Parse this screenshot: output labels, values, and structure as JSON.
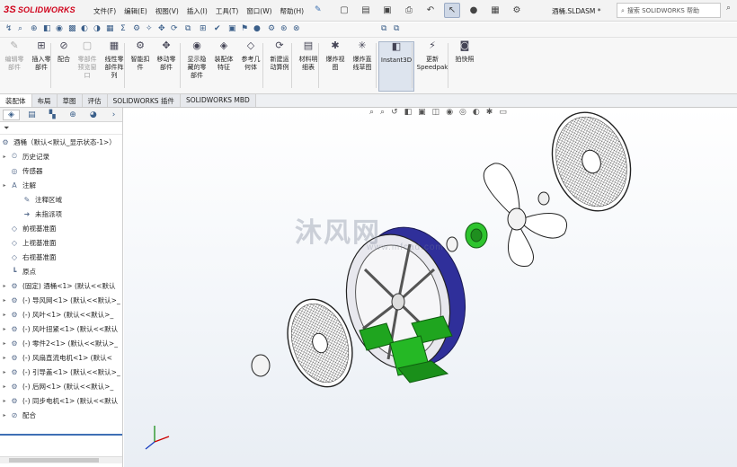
{
  "app": {
    "logo": "SOLIDWORKS",
    "logo_mark": "3S"
  },
  "menu": [
    "文件(F)",
    "编辑(E)",
    "视图(V)",
    "插入(I)",
    "工具(T)",
    "窗口(W)",
    "帮助(H)"
  ],
  "filename": "酒桶.SLDASM *",
  "search": {
    "placeholder": "搜索 SOLIDWORKS 帮助"
  },
  "ribbon": [
    {
      "label": "编辑零\n部件",
      "icon": "edit-component-icon",
      "enabled": false
    },
    {
      "label": "插入零\n部件",
      "icon": "insert-component-icon",
      "enabled": true
    },
    {
      "label": "配合",
      "icon": "mate-icon",
      "enabled": true
    },
    {
      "label": "零部件\n预览窗\n口",
      "icon": "component-preview-icon",
      "enabled": false
    },
    {
      "label": "线性零\n部件阵\n列",
      "icon": "linear-pattern-icon",
      "enabled": true
    },
    {
      "label": "智能扣\n件",
      "icon": "smart-fastener-icon",
      "enabled": true
    },
    {
      "label": "移动零\n部件",
      "icon": "move-component-icon",
      "enabled": true
    },
    {
      "label": "显示隐\n藏的零\n部件",
      "icon": "show-hidden-icon",
      "enabled": true
    },
    {
      "label": "装配体\n特征",
      "icon": "assembly-feature-icon",
      "enabled": true
    },
    {
      "label": "参考几\n何体",
      "icon": "reference-geometry-icon",
      "enabled": true
    },
    {
      "label": "新建运\n动算例",
      "icon": "motion-study-icon",
      "enabled": true
    },
    {
      "label": "材料明\n细表",
      "icon": "bom-icon",
      "enabled": true
    },
    {
      "label": "爆炸视\n图",
      "icon": "explode-view-icon",
      "enabled": true
    },
    {
      "label": "爆炸直\n线草图",
      "icon": "explode-line-icon",
      "enabled": true
    },
    {
      "label": "Instant3D",
      "icon": "instant3d-icon",
      "enabled": true
    },
    {
      "label": "更新\nSpeedpak",
      "icon": "speedpak-icon",
      "enabled": true
    },
    {
      "label": "拍快照",
      "icon": "snapshot-icon",
      "enabled": true
    }
  ],
  "tabs": [
    "装配体",
    "布局",
    "草图",
    "评估",
    "SOLIDWORKS 插件",
    "SOLIDWORKS MBD"
  ],
  "active_tab": "装配体",
  "tree": {
    "root": "酒桶（默认<默认_显示状态-1>）",
    "items": [
      {
        "label": "历史记录",
        "icon": "history-icon",
        "expand": true,
        "indent": 1
      },
      {
        "label": "传感器",
        "icon": "sensor-icon",
        "expand": false,
        "indent": 1
      },
      {
        "label": "注解",
        "icon": "annotation-icon",
        "expand": true,
        "indent": 1
      },
      {
        "label": "注释区域",
        "icon": "note-area-icon",
        "expand": false,
        "indent": 2
      },
      {
        "label": "未指派项",
        "icon": "unassigned-icon",
        "expand": false,
        "indent": 2
      },
      {
        "label": "前视基准面",
        "icon": "plane-icon",
        "expand": false,
        "indent": 1
      },
      {
        "label": "上视基准面",
        "icon": "plane-icon",
        "expand": false,
        "indent": 1
      },
      {
        "label": "右视基准面",
        "icon": "plane-icon",
        "expand": false,
        "indent": 1
      },
      {
        "label": "原点",
        "icon": "origin-icon",
        "expand": false,
        "indent": 1
      },
      {
        "label": "(固定) 酒桶<1> (默认<<默认",
        "icon": "part-icon",
        "expand": true,
        "indent": 1
      },
      {
        "label": "(-) 导风网<1> (默认<<默认>_",
        "icon": "part-icon",
        "expand": true,
        "indent": 1
      },
      {
        "label": "(-) 风叶<1> (默认<<默认>_",
        "icon": "part-icon",
        "expand": true,
        "indent": 1
      },
      {
        "label": "(-) 风叶扭紧<1> (默认<<默认",
        "icon": "part-icon",
        "expand": true,
        "indent": 1
      },
      {
        "label": "(-) 零件2<1> (默认<<默认>_",
        "icon": "part-icon",
        "expand": true,
        "indent": 1
      },
      {
        "label": "(-) 风扇直流电机<1> (默认<",
        "icon": "subassembly-icon",
        "expand": true,
        "indent": 1
      },
      {
        "label": "(-) 引导盖<1> (默认<<默认>_",
        "icon": "part-icon",
        "expand": true,
        "indent": 1
      },
      {
        "label": "(-) 后网<1> (默认<<默认>_",
        "icon": "part-icon",
        "expand": true,
        "indent": 1
      },
      {
        "label": "(-) 同步电机<1> (默认<<默认",
        "icon": "part-icon",
        "expand": true,
        "indent": 1
      },
      {
        "label": "配合",
        "icon": "mates-folder-icon",
        "expand": true,
        "indent": 1
      }
    ]
  },
  "watermark": {
    "text": "沐风网",
    "url": "www.mfcad.com"
  },
  "colors": {
    "accent": "#3f6fb5",
    "logo": "#d0021b",
    "drum": "#2f2f9a",
    "base": "#1fa51f"
  }
}
